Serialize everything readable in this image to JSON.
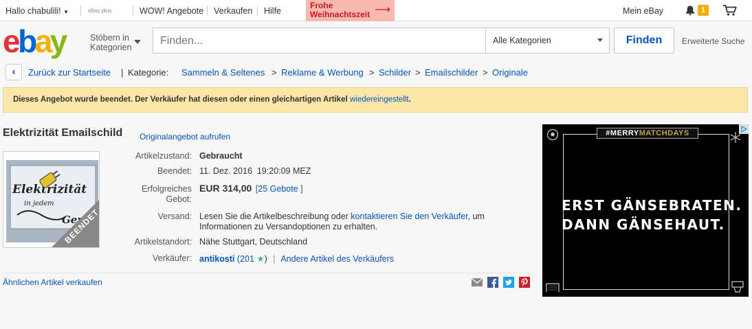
{
  "topbar": {
    "greeting": "Hallo chabulili!",
    "plus": "ebay plus",
    "wow": "WOW! Angebote",
    "sell": "Verkaufen",
    "help": "Hilfe",
    "xmas_line1": "Frohe",
    "xmas_line2": "Weihnachtszeit",
    "my_ebay": "Mein eBay",
    "notification_count": "1"
  },
  "header": {
    "browse_line1": "Stöbern in",
    "browse_line2": "Kategorien",
    "search_placeholder": "Finden...",
    "category_select": "Alle Kategorien",
    "find_button": "Finden",
    "advanced_search": "Erweiterte Suche"
  },
  "breadcrumb": {
    "back": "Zurück zur Startseite",
    "category_label": "Kategorie:",
    "items": [
      "Sammeln & Seltenes",
      "Reklame & Werbung",
      "Schilder",
      "Emailschilder",
      "Originale"
    ]
  },
  "alert": {
    "text": "Dieses Angebot wurde beendet. Der Verkäufer hat diesen oder einen gleichartigen Artikel",
    "link": "wiedereingestellt",
    "end": "."
  },
  "item": {
    "title": "Elektrizität Emailschild",
    "original_link": "Originalangebot aufrufen",
    "ended_ribbon": "BEENDET",
    "image_text_line1": "Elektrizität",
    "image_text_line2": "in jedem",
    "image_text_line3": "Ger",
    "condition_label": "Artikelzustand:",
    "condition_value": "Gebraucht",
    "ended_label": "Beendet:",
    "ended_value": "11. Dez. 2016  19:20:09 MEZ",
    "bid_label_1": "Erfolgreiches",
    "bid_label_2": "Gebot:",
    "price": "EUR 314,00",
    "bids_open": "[",
    "bids": "25 Gebote",
    "bids_close": "]",
    "shipping_label": "Versand:",
    "shipping_pre": "Lesen Sie die Artikelbeschreibung oder",
    "shipping_link": "kontaktieren Sie den Verkäufer",
    "shipping_post": ", um",
    "shipping_line2": "Informationen zu Versandoptionen zu erhalten.",
    "location_label": "Artikelstandort:",
    "location_value": "Nähe Stuttgart, Deutschland",
    "seller_label": "Verkäufer:",
    "seller_name": "antikosti",
    "seller_score_open": "(201",
    "seller_score_close": ")",
    "seller_sep": "|",
    "seller_other": "Andere Artikel des Verkäufers",
    "similar": "Ähnlichen Artikel verkaufen"
  },
  "ad": {
    "tag_1": "#MERRY",
    "tag_2": "MATCHDAYS",
    "line1": "ERST GÄNSEBRATEN.",
    "line2": "DANN GÄNSEHAUT."
  },
  "colors": {
    "link": "#0654ba",
    "alert_bg": "#fbe8a9",
    "star": "#3eb3a6",
    "xmas_bg": "#f9b9b0"
  }
}
